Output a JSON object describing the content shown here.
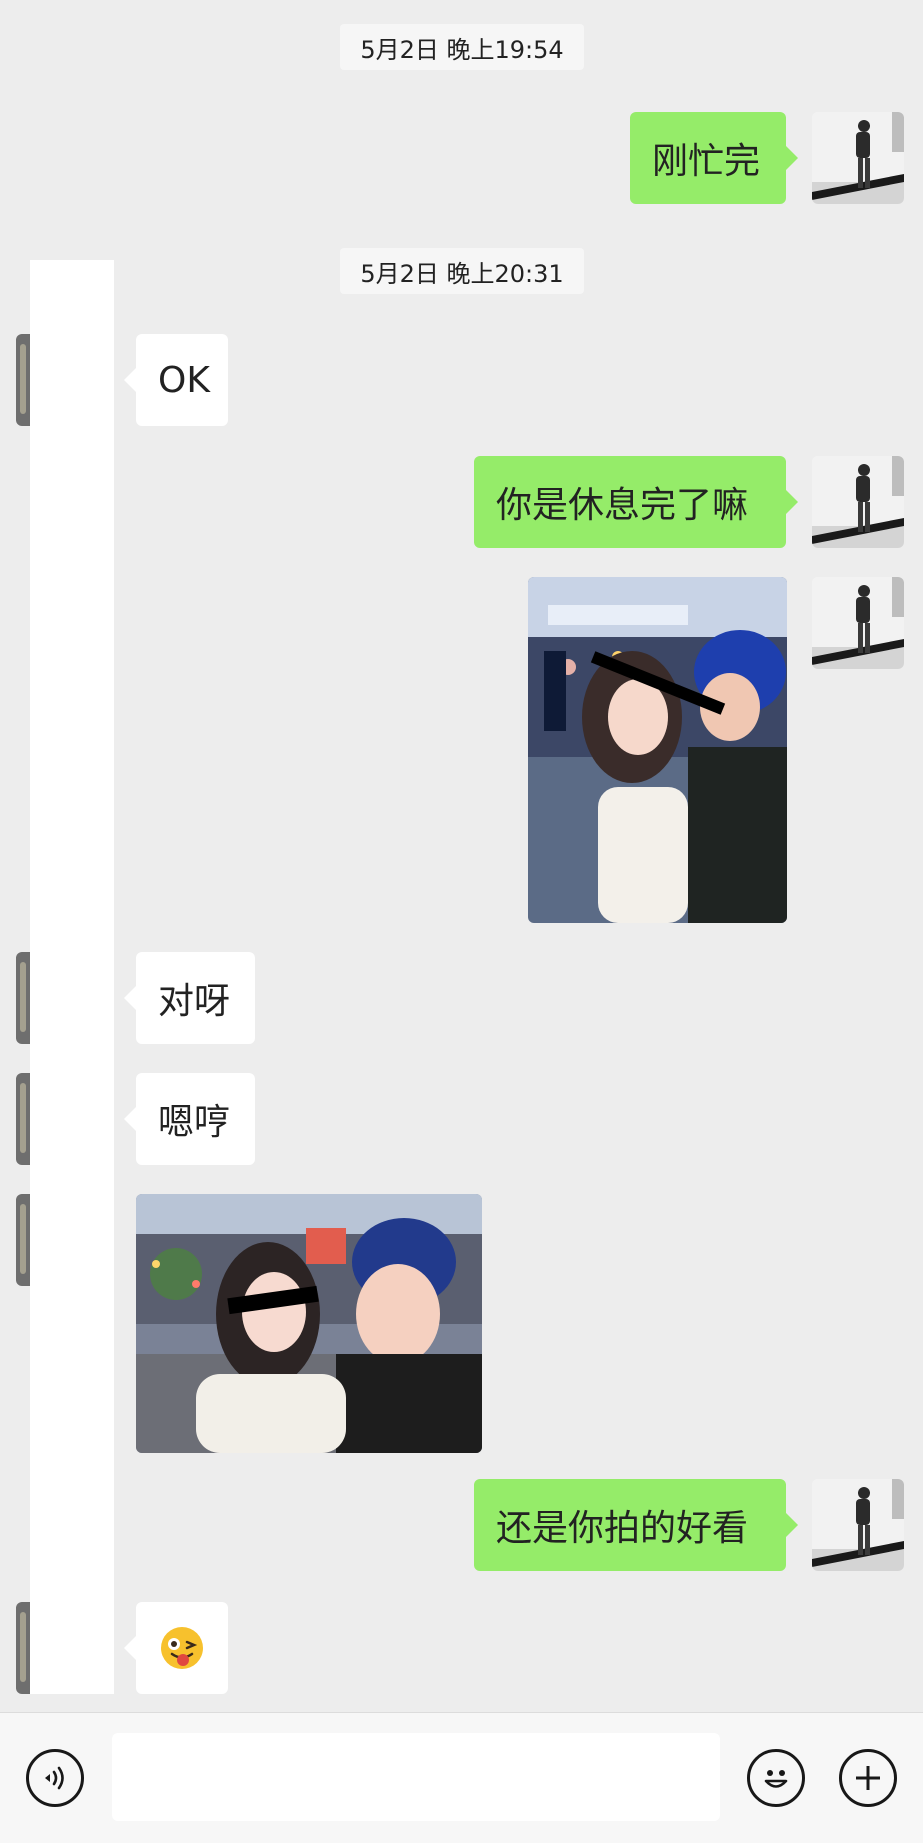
{
  "chat": {
    "timestamps": [
      "5月2日 晚上19:54",
      "5月2日 晚上20:31"
    ],
    "messages": [
      {
        "from": "me",
        "type": "text",
        "text": "刚忙完"
      },
      {
        "from": "other",
        "type": "text",
        "text": "OK"
      },
      {
        "from": "me",
        "type": "text",
        "text": "你是休息完了嘛"
      },
      {
        "from": "me",
        "type": "image",
        "description": "selfie"
      },
      {
        "from": "other",
        "type": "text",
        "text": "对呀"
      },
      {
        "from": "other",
        "type": "text",
        "text": "嗯哼"
      },
      {
        "from": "other",
        "type": "image",
        "description": "selfie"
      },
      {
        "from": "me",
        "type": "text",
        "text": "还是你拍的好看"
      },
      {
        "from": "other",
        "type": "emoji",
        "text": "😜"
      }
    ]
  },
  "input_bar": {
    "voice_icon": "voice-icon",
    "emoji_icon": "emoji-icon",
    "plus_icon": "plus-icon"
  },
  "colors": {
    "background": "#ededed",
    "my_bubble": "#95ec69",
    "their_bubble": "#ffffff"
  }
}
